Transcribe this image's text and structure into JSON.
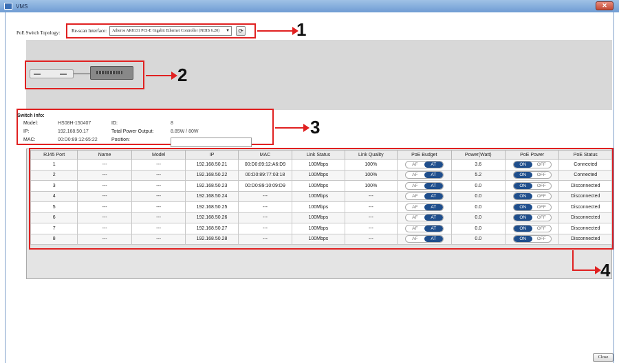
{
  "window": {
    "title": "VMS",
    "close_glyph": "✕"
  },
  "topology": {
    "label": "PoE Switch Topology:"
  },
  "interface": {
    "label": "Re-scan Interface:",
    "selected": "Atheros AR8131 PCI-E Gigabit Ethernet Controller (NDIS 6.20)",
    "caret": "▼",
    "refresh_icon": "⟳"
  },
  "callouts": [
    "1",
    "2",
    "3",
    "4"
  ],
  "switch_info": {
    "title": "Switch Info:",
    "model_label": "Model:",
    "model": "HS08H-150407",
    "ip_label": "IP:",
    "ip": "192.168.50.17",
    "mac_label": "MAC:",
    "mac": "00:D0:89:12:65:22",
    "id_label": "ID:",
    "id": "8",
    "power_label": "Total Power Output:",
    "power": "8.85W / 80W",
    "position_label": "Position:",
    "position": ""
  },
  "table": {
    "headers": [
      "RJ45 Port",
      "Name",
      "Model",
      "IP",
      "MAC",
      "Link Status",
      "Link Quality",
      "PoE Budget",
      "Power(Watt)",
      "PoE Power",
      "PoE Status"
    ],
    "budget_options": [
      "AF",
      "AT"
    ],
    "power_options": [
      "ON",
      "OFF"
    ],
    "rows": [
      {
        "port": "1",
        "name": "---",
        "model": "---",
        "ip": "192.168.50.21",
        "mac": "00:D0:89:12:A6:D9",
        "link": "100Mbps",
        "quality": "100%",
        "budget": "AT",
        "watt": "3.6",
        "power": "ON",
        "status": "Connected"
      },
      {
        "port": "2",
        "name": "---",
        "model": "---",
        "ip": "192.168.50.22",
        "mac": "00:D0:89:77:03:18",
        "link": "100Mbps",
        "quality": "100%",
        "budget": "AT",
        "watt": "5.2",
        "power": "ON",
        "status": "Connected"
      },
      {
        "port": "3",
        "name": "---",
        "model": "---",
        "ip": "192.168.50.23",
        "mac": "00:D0:89:10:09:D9",
        "link": "100Mbps",
        "quality": "100%",
        "budget": "AT",
        "watt": "0.0",
        "power": "ON",
        "status": "Disconnected"
      },
      {
        "port": "4",
        "name": "---",
        "model": "---",
        "ip": "192.168.50.24",
        "mac": "---",
        "link": "100Mbps",
        "quality": "---",
        "budget": "AT",
        "watt": "0.0",
        "power": "ON",
        "status": "Disconnected"
      },
      {
        "port": "5",
        "name": "---",
        "model": "---",
        "ip": "192.168.50.25",
        "mac": "---",
        "link": "100Mbps",
        "quality": "---",
        "budget": "AT",
        "watt": "0.0",
        "power": "ON",
        "status": "Disconnected"
      },
      {
        "port": "6",
        "name": "---",
        "model": "---",
        "ip": "192.168.50.26",
        "mac": "---",
        "link": "100Mbps",
        "quality": "---",
        "budget": "AT",
        "watt": "0.0",
        "power": "ON",
        "status": "Disconnected"
      },
      {
        "port": "7",
        "name": "---",
        "model": "---",
        "ip": "192.168.50.27",
        "mac": "---",
        "link": "100Mbps",
        "quality": "---",
        "budget": "AT",
        "watt": "0.0",
        "power": "ON",
        "status": "Disconnected"
      },
      {
        "port": "8",
        "name": "---",
        "model": "---",
        "ip": "192.168.50.28",
        "mac": "---",
        "link": "100Mbps",
        "quality": "---",
        "budget": "AT",
        "watt": "0.0",
        "power": "ON",
        "status": "Disconnected"
      }
    ]
  },
  "footer": {
    "close_label": "Close"
  },
  "colors": {
    "callout": "#e02020",
    "toggle_active": "#1f4e8c"
  }
}
